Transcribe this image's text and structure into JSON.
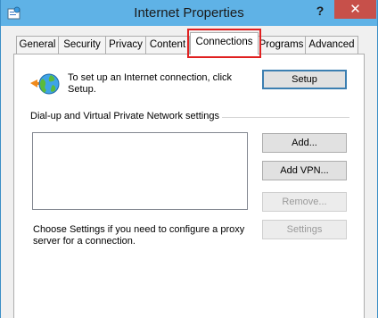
{
  "window": {
    "title": "Internet Properties",
    "help_label": "?",
    "close_label": "✕",
    "app_icon": "internet-options-icon"
  },
  "tabs": [
    {
      "label": "General"
    },
    {
      "label": "Security"
    },
    {
      "label": "Privacy"
    },
    {
      "label": "Content"
    },
    {
      "label": "Connections",
      "active": true
    },
    {
      "label": "Programs"
    },
    {
      "label": "Advanced"
    }
  ],
  "connections": {
    "setup_text": "To set up an Internet connection, click Setup.",
    "setup_button": "Setup",
    "vpn_section_label": "Dial-up and Virtual Private Network settings",
    "add_button": "Add...",
    "add_vpn_button": "Add VPN...",
    "remove_button": "Remove...",
    "settings_text": "Choose Settings if you need to configure a proxy server for a connection.",
    "settings_button": "Settings"
  },
  "colors": {
    "titlebar": "#5fb2e6",
    "close": "#c7504a",
    "highlight": "#e02020"
  }
}
